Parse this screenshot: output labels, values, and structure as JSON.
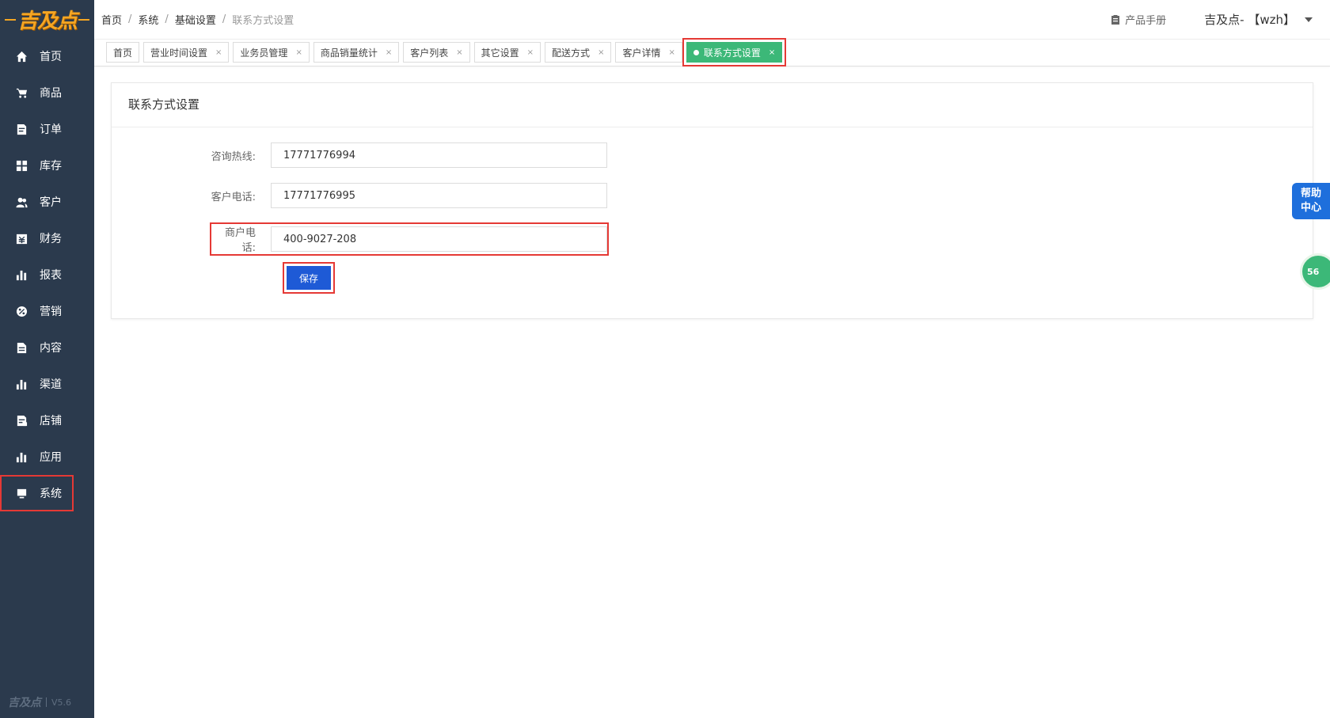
{
  "logo": {
    "text": "吉及点"
  },
  "sidebar": {
    "items": [
      {
        "label": "首页",
        "icon": "home-icon"
      },
      {
        "label": "商品",
        "icon": "cart-icon"
      },
      {
        "label": "订单",
        "icon": "order-icon"
      },
      {
        "label": "库存",
        "icon": "grid-icon"
      },
      {
        "label": "客户",
        "icon": "users-icon"
      },
      {
        "label": "财务",
        "icon": "finance-icon"
      },
      {
        "label": "报表",
        "icon": "bar-chart-icon"
      },
      {
        "label": "营销",
        "icon": "percent-icon"
      },
      {
        "label": "内容",
        "icon": "document-icon"
      },
      {
        "label": "渠道",
        "icon": "bar-chart-icon"
      },
      {
        "label": "店铺",
        "icon": "store-icon"
      },
      {
        "label": "应用",
        "icon": "bar-chart-icon"
      },
      {
        "label": "系统",
        "icon": "monitor-icon"
      }
    ],
    "active_index": 12,
    "footer_logo": "吉及点",
    "version": "V5.6"
  },
  "header": {
    "breadcrumb": [
      "首页",
      "系统",
      "基础设置",
      "联系方式设置"
    ],
    "separator": "/",
    "manual_label": "产品手册",
    "user_label": "吉及点- 【wzh】"
  },
  "tabs": [
    {
      "label": "首页",
      "closable": false
    },
    {
      "label": "营业时间设置",
      "closable": true
    },
    {
      "label": "业务员管理",
      "closable": true
    },
    {
      "label": "商品销量统计",
      "closable": true
    },
    {
      "label": "客户列表",
      "closable": true
    },
    {
      "label": "其它设置",
      "closable": true
    },
    {
      "label": "配送方式",
      "closable": true
    },
    {
      "label": "客户详情",
      "closable": true
    },
    {
      "label": "联系方式设置",
      "closable": true,
      "active": true
    }
  ],
  "tab_close_glyph": "×",
  "panel": {
    "title": "联系方式设置",
    "fields": [
      {
        "label": "咨询热线:",
        "value": "17771776994"
      },
      {
        "label": "客户电话:",
        "value": "17771776995"
      },
      {
        "label": "商户电话:",
        "value": "400-9027-208"
      }
    ],
    "save_label": "保存"
  },
  "help": {
    "line1": "帮助",
    "line2": "中心"
  },
  "float_badge": "56",
  "colors": {
    "sidebar_bg": "#2b3a4d",
    "accent_blue": "#1e5ad6",
    "active_tab": "#3cb878",
    "highlight": "#e53935",
    "logo": "#f5a623"
  }
}
